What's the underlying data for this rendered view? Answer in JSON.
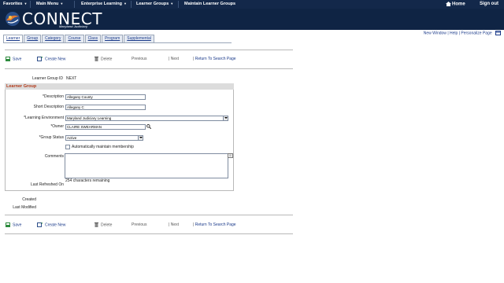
{
  "topnav": {
    "favorites": "Favorites",
    "main_menu": "Main Menu",
    "enterprise_learning": "Enterprise Learning",
    "learner_groups": "Learner Groups",
    "maintain_learner_groups": "Maintain Learner Groups",
    "home": "Home",
    "sign_out": "Sign out"
  },
  "brand": {
    "name": "CONNECT",
    "subtitle": "Maryland Judiciary"
  },
  "header_links": {
    "new_window": "New Window",
    "help": "Help",
    "personalize_page": "Personalize Page"
  },
  "tabs": [
    "Learner",
    "Group",
    "Category",
    "Course",
    "Class",
    "Program",
    "Supplemental"
  ],
  "toolbar": {
    "save": "Save",
    "create_new": "Create New",
    "delete": "Delete",
    "previous": "Previous",
    "next": "Next",
    "return_to_search": "Return To Search Page"
  },
  "form": {
    "learner_group_id_label": "Learner Group ID",
    "learner_group_id_value": "NEXT",
    "section_title": "Learner Group",
    "description_label": "*Description",
    "description_value": "Allegany County",
    "short_description_label": "Short Description",
    "short_description_value": "Allegany C",
    "learning_environment_label": "*Learning Environment",
    "learning_environment_value": "Maryland Judiciary Learning",
    "owner_label": "*Owner",
    "owner_value": "CLAIRE SWEARMAN",
    "group_status_label": "*Group Status",
    "group_status_value": "Active",
    "auto_membership_label": "Automatically maintain membership",
    "auto_membership_checked": false,
    "comments_label": "Comments",
    "comments_value": "",
    "chars_remaining": "254 characters remaining",
    "last_refreshed_label": "Last Refreshed On",
    "created_label": "Created",
    "last_modified_label": "Last Modified"
  },
  "colors": {
    "nav_bg": "#13284a",
    "banner_bg": "#0f2444",
    "link": "#1a3a8a",
    "section_title": "#b23a1a"
  }
}
